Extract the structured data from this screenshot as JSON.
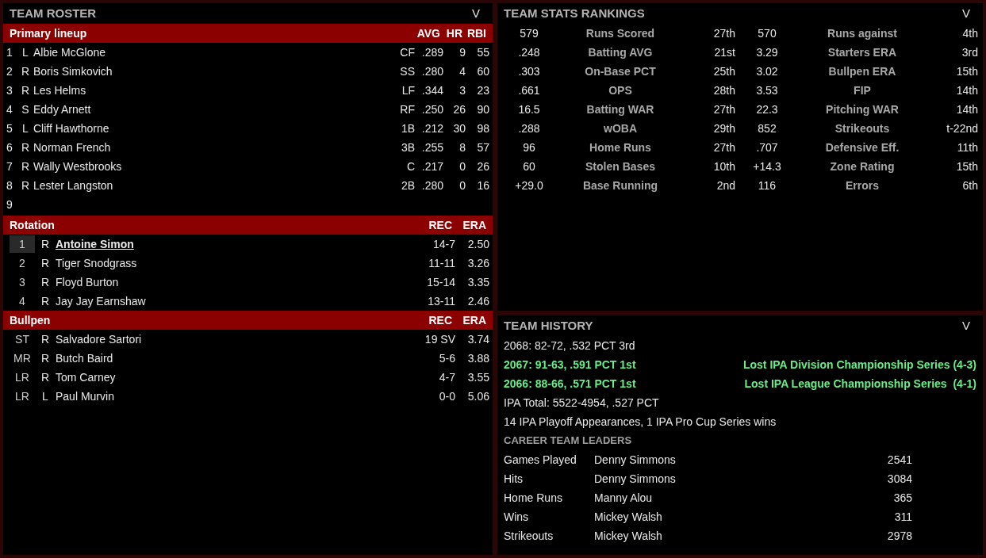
{
  "roster": {
    "title": "TEAM ROSTER",
    "toggle": "V",
    "lineup": {
      "label": "Primary lineup",
      "columns": [
        "AVG",
        "HR",
        "RBI"
      ],
      "rows": [
        {
          "order": "1",
          "hand": "L",
          "name": "Albie McGlone",
          "pos": "CF",
          "avg": ".289",
          "hr": "9",
          "rbi": "55"
        },
        {
          "order": "2",
          "hand": "R",
          "name": "Boris Simkovich",
          "pos": "SS",
          "avg": ".280",
          "hr": "4",
          "rbi": "60"
        },
        {
          "order": "3",
          "hand": "R",
          "name": "Les Helms",
          "pos": "LF",
          "avg": ".344",
          "hr": "3",
          "rbi": "23"
        },
        {
          "order": "4",
          "hand": "S",
          "name": "Eddy Arnett",
          "pos": "RF",
          "avg": ".250",
          "hr": "26",
          "rbi": "90"
        },
        {
          "order": "5",
          "hand": "L",
          "name": "Cliff Hawthorne",
          "pos": "1B",
          "avg": ".212",
          "hr": "30",
          "rbi": "98"
        },
        {
          "order": "6",
          "hand": "R",
          "name": "Norman French",
          "pos": "3B",
          "avg": ".255",
          "hr": "8",
          "rbi": "57"
        },
        {
          "order": "7",
          "hand": "R",
          "name": "Wally Westbrooks",
          "pos": "C",
          "avg": ".217",
          "hr": "0",
          "rbi": "26"
        },
        {
          "order": "8",
          "hand": "R",
          "name": "Lester Langston",
          "pos": "2B",
          "avg": ".280",
          "hr": "0",
          "rbi": "16"
        },
        {
          "order": "9"
        }
      ]
    },
    "rotation": {
      "label": "Rotation",
      "columns": [
        "REC",
        "ERA"
      ],
      "rows": [
        {
          "role": "1",
          "hand": "R",
          "name": "Antoine Simon",
          "rec": "14-7",
          "era": "2.50",
          "selected": true
        },
        {
          "role": "2",
          "hand": "R",
          "name": "Tiger Snodgrass",
          "rec": "11-11",
          "era": "3.26",
          "selected": false
        },
        {
          "role": "3",
          "hand": "R",
          "name": "Floyd Burton",
          "rec": "15-14",
          "era": "3.35",
          "selected": false
        },
        {
          "role": "4",
          "hand": "R",
          "name": "Jay Jay Earnshaw",
          "rec": "13-11",
          "era": "2.46",
          "selected": false
        }
      ]
    },
    "bullpen": {
      "label": "Bullpen",
      "columns": [
        "REC",
        "ERA"
      ],
      "rows": [
        {
          "role": "ST",
          "hand": "R",
          "name": "Salvadore Sartori",
          "rec": "19 SV",
          "era": "3.74",
          "selected": false
        },
        {
          "role": "MR",
          "hand": "R",
          "name": "Butch Baird",
          "rec": "5-6",
          "era": "3.88",
          "selected": false
        },
        {
          "role": "LR",
          "hand": "R",
          "name": "Tom Carney",
          "rec": "4-7",
          "era": "3.55",
          "selected": false
        },
        {
          "role": "LR",
          "hand": "L",
          "name": "Paul Murvin",
          "rec": "0-0",
          "era": "5.06",
          "selected": false
        }
      ]
    }
  },
  "rankings": {
    "title": "TEAM STATS RANKINGS",
    "toggle": "V",
    "rows": [
      {
        "value": "579",
        "stat": "Runs Scored",
        "rank": "27th",
        "value_2": "570",
        "stat_2": "Runs against",
        "rank_2": "4th"
      },
      {
        "value": ".248",
        "stat": "Batting AVG",
        "rank": "21st",
        "value_2": "3.29",
        "stat_2": "Starters ERA",
        "rank_2": "3rd"
      },
      {
        "value": ".303",
        "stat": "On-Base PCT",
        "rank": "25th",
        "value_2": "3.02",
        "stat_2": "Bullpen ERA",
        "rank_2": "15th"
      },
      {
        "value": ".661",
        "stat": "OPS",
        "rank": "28th",
        "value_2": "3.53",
        "stat_2": "FIP",
        "rank_2": "14th"
      },
      {
        "value": "16.5",
        "stat": "Batting WAR",
        "rank": "27th",
        "value_2": "22.3",
        "stat_2": "Pitching WAR",
        "rank_2": "14th"
      },
      {
        "value": ".288",
        "stat": "wOBA",
        "rank": "29th",
        "value_2": "852",
        "stat_2": "Strikeouts",
        "rank_2": "t-22nd"
      },
      {
        "value": "96",
        "stat": "Home Runs",
        "rank": "27th",
        "value_2": ".707",
        "stat_2": "Defensive Eff.",
        "rank_2": "11th"
      },
      {
        "value": "60",
        "stat": "Stolen Bases",
        "rank": "10th",
        "value_2": "+14.3",
        "stat_2": "Zone Rating",
        "rank_2": "15th"
      },
      {
        "value": "+29.0",
        "stat": "Base Running",
        "rank": "2nd",
        "value_2": "116",
        "stat_2": "Errors",
        "rank_2": "6th"
      }
    ]
  },
  "history": {
    "title": "TEAM HISTORY",
    "toggle": "V",
    "seasons": [
      {
        "kind": "regular",
        "text": "2068: 82-72, .532 PCT 3rd"
      },
      {
        "kind": "playoff",
        "text": "2067: 91-63, .591 PCT 1st",
        "result": "Lost IPA Division Championship Series (4-3)"
      },
      {
        "kind": "playoff",
        "text": "2066: 88-66, .571 PCT 1st",
        "result": "Lost IPA League Championship Series  (4-1)"
      }
    ],
    "total": "IPA Total: 5522-4954, .527 PCT",
    "summary": "14 IPA Playoff Appearances, 1 IPA Pro Cup Series wins",
    "leaders_title": "CAREER TEAM LEADERS",
    "leaders": [
      {
        "category": "Games Played",
        "name": "Denny Simmons",
        "value": "2541"
      },
      {
        "category": "Hits",
        "name": "Denny Simmons",
        "value": "3084"
      },
      {
        "category": "Home Runs",
        "name": "Manny Alou",
        "value": "365"
      },
      {
        "category": "Wins",
        "name": "Mickey Walsh",
        "value": "311"
      },
      {
        "category": "Strikeouts",
        "name": "Mickey Walsh",
        "value": "2978"
      }
    ]
  }
}
